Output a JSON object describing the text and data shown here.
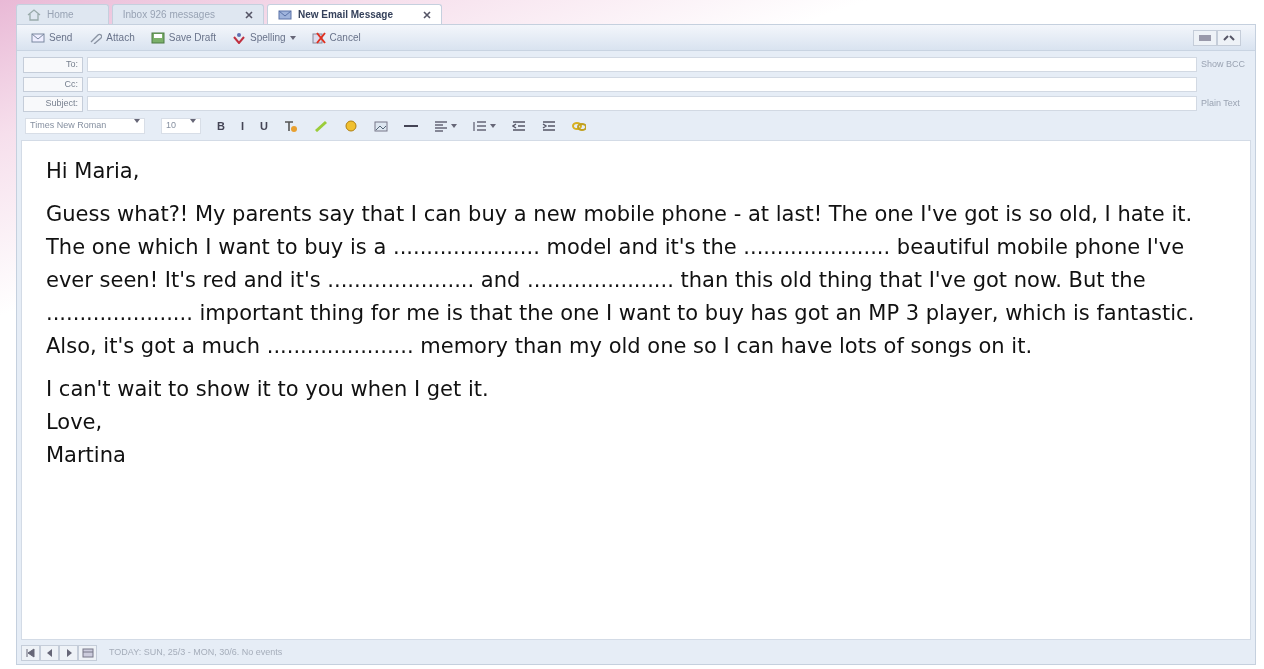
{
  "tabs": [
    {
      "label": "Home",
      "kind": "home",
      "closable": false,
      "selected": false
    },
    {
      "label": "Inbox 926 messages",
      "kind": "plain",
      "closable": true,
      "selected": false
    },
    {
      "label": "New Email Message",
      "kind": "mail",
      "closable": true,
      "selected": true
    }
  ],
  "toolbar": [
    {
      "label": "Send",
      "kind": "send",
      "dropdown": false
    },
    {
      "label": "Attach",
      "kind": "attach",
      "dropdown": false
    },
    {
      "label": "Save Draft",
      "kind": "save",
      "dropdown": false
    },
    {
      "label": "Spelling",
      "kind": "spelling",
      "dropdown": true
    },
    {
      "label": "Cancel",
      "kind": "cancel",
      "dropdown": false
    }
  ],
  "fields": [
    {
      "label": "To:",
      "side": "Show BCC"
    },
    {
      "label": "Cc:"
    },
    {
      "label": "Subject:",
      "side": "Plain Text"
    }
  ],
  "format_toolbar": {
    "font": "Times New Roman",
    "size": "10",
    "tools": [
      {
        "kind": "glyph",
        "text": "B"
      },
      {
        "kind": "glyph",
        "text": "I"
      },
      {
        "kind": "glyph",
        "text": "U"
      },
      {
        "kind": "text-color"
      },
      {
        "kind": "highlight"
      },
      {
        "kind": "smiley"
      },
      {
        "kind": "image"
      },
      {
        "kind": "rule"
      },
      {
        "kind": "align",
        "dropdown": true
      },
      {
        "kind": "list",
        "dropdown": true
      },
      {
        "kind": "outdent"
      },
      {
        "kind": "indent"
      },
      {
        "kind": "link"
      }
    ]
  },
  "body": [
    {
      "lines": [
        "Hi Maria,"
      ]
    },
    {
      "lines": [
        "Guess what?! My parents say that I can buy a new mobile phone - at last! The one I've got is so old, I hate it. The one which I want to buy is a ...................... model and it's the ...................... beautiful mobile phone I've ever seen! It's red and it's ...................... and ...................... than this old thing that I've got now. But the ...................... important thing for me is that the one I want to buy has got an MP 3 player, which is fantastic. Also, it's got a much ...................... memory than my old one so I can have lots of songs on it."
      ]
    },
    {
      "lines": [
        "I can't wait to show it to you when I get it.",
        "Love,",
        "Martina"
      ]
    }
  ],
  "status_bar": {
    "buttons": [
      {
        "kind": "first"
      },
      {
        "kind": "prev"
      },
      {
        "kind": "next"
      },
      {
        "kind": "calendar"
      }
    ],
    "text": "TODAY: SUN, 25/3 - MON, 30/6. No events"
  }
}
